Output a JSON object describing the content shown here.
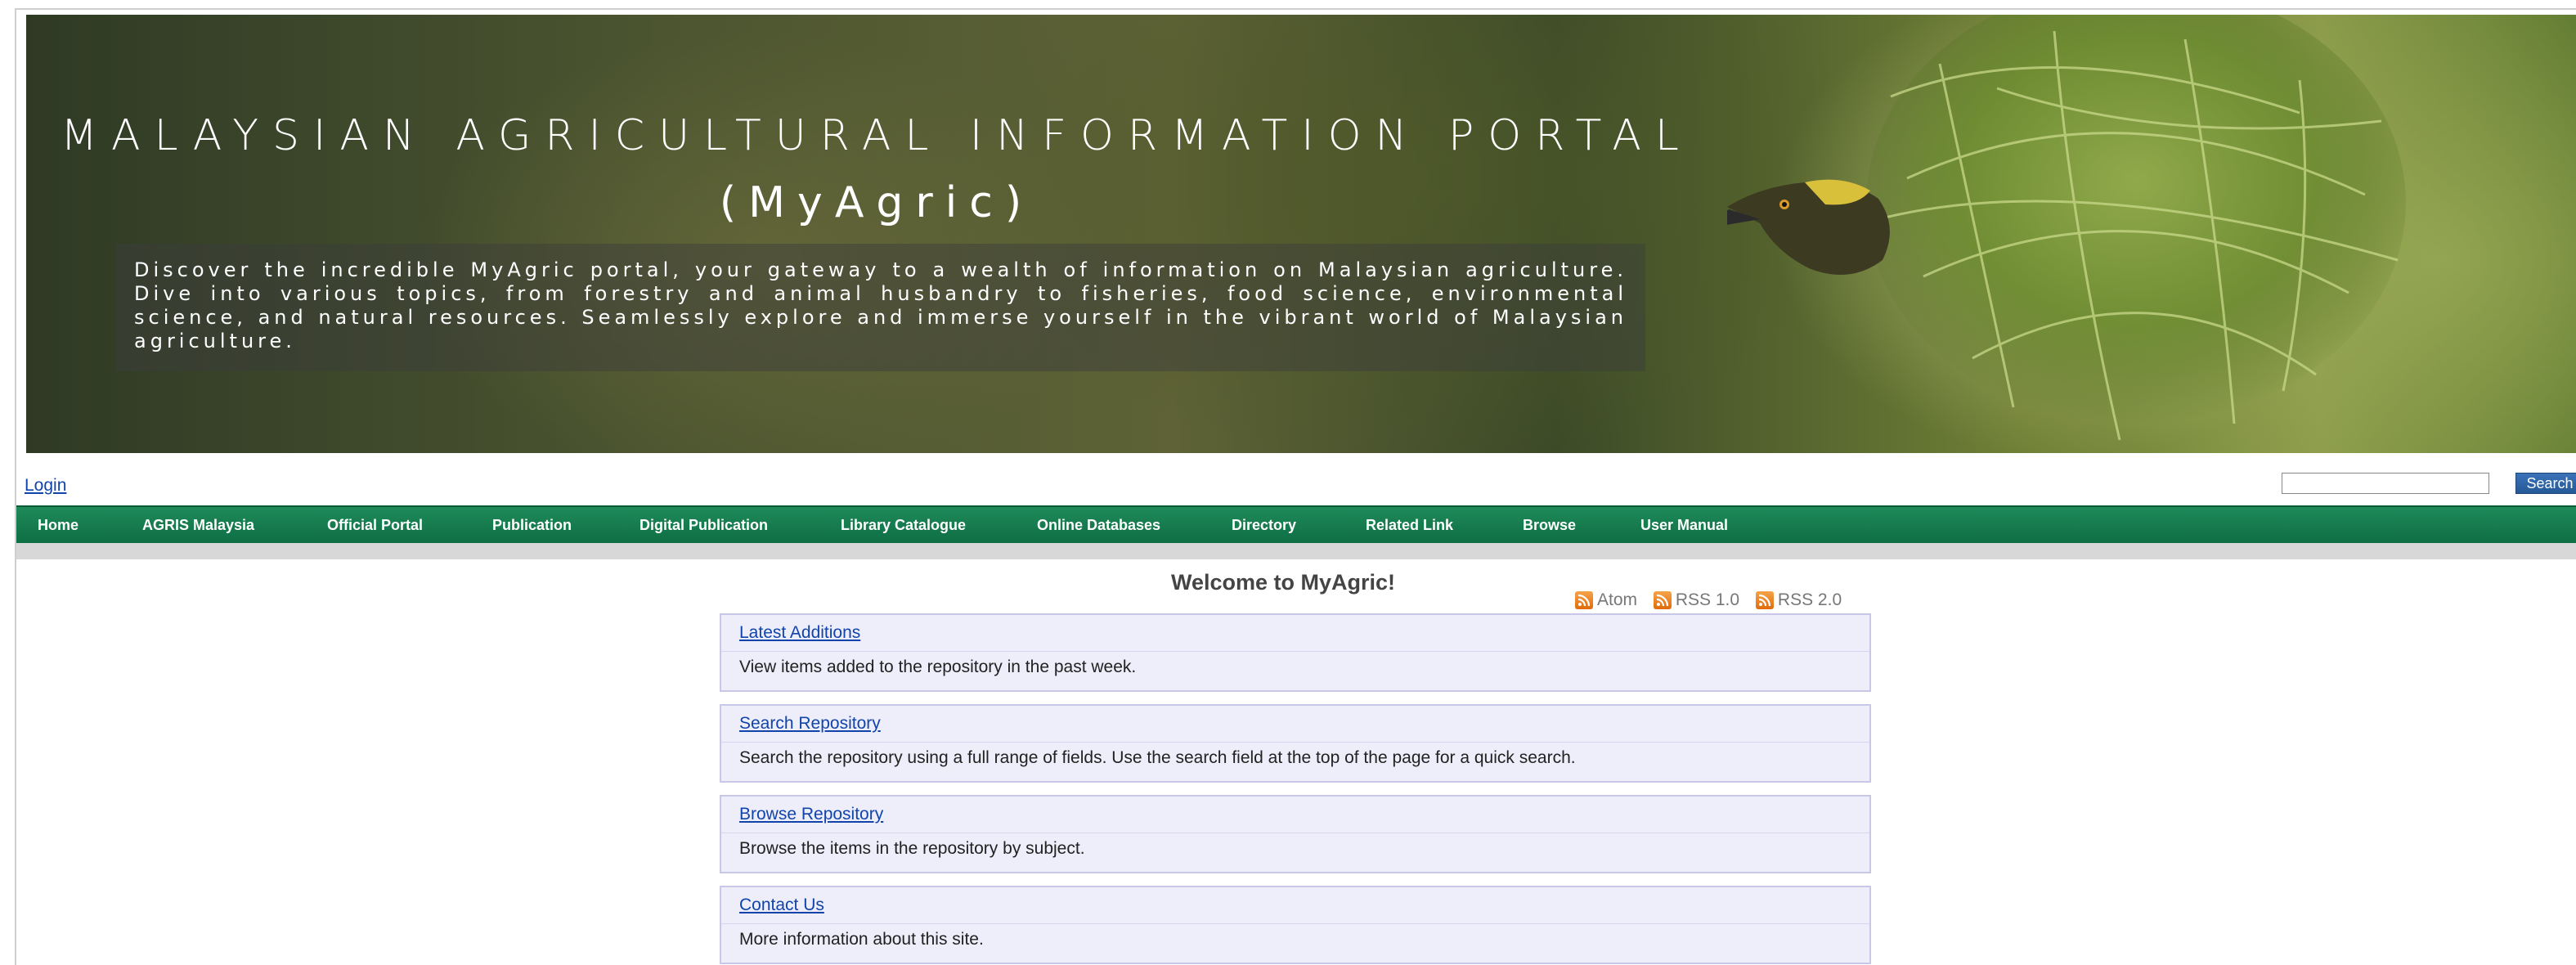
{
  "banner": {
    "title": "MALAYSIAN AGRICULTURAL INFORMATION PORTAL",
    "subtitle": "(MyAgric)",
    "description": "Discover the incredible MyAgric portal, your gateway to a wealth of information on Malaysian agriculture. Dive into various topics, from forestry and animal husbandry to fisheries, food science, environmental science, and natural resources. Seamlessly explore and immerse yourself in the vibrant world of Malaysian agriculture."
  },
  "topbar": {
    "login_label": "Login",
    "search_placeholder": "",
    "search_button_label": "Search"
  },
  "nav": {
    "items": [
      {
        "label": "Home"
      },
      {
        "label": "AGRIS Malaysia"
      },
      {
        "label": "Official Portal"
      },
      {
        "label": "Publication"
      },
      {
        "label": "Digital Publication"
      },
      {
        "label": "Library Catalogue"
      },
      {
        "label": "Online Databases"
      },
      {
        "label": "Directory"
      },
      {
        "label": "Related Link"
      },
      {
        "label": "Browse"
      },
      {
        "label": "User Manual"
      }
    ]
  },
  "main": {
    "welcome_title": "Welcome to MyAgric!",
    "feeds": [
      {
        "label": "Atom",
        "icon": "rss-icon"
      },
      {
        "label": "RSS 1.0",
        "icon": "rss-icon"
      },
      {
        "label": "RSS 2.0",
        "icon": "rss-icon"
      }
    ],
    "cards": [
      {
        "link": "Latest Additions",
        "desc": "View items added to the repository in the past week."
      },
      {
        "link": "Search Repository",
        "desc": "Search the repository using a full range of fields. Use the search field at the top of the page for a quick search."
      },
      {
        "link": "Browse Repository",
        "desc": "Browse the items in the repository by subject."
      },
      {
        "link": "Contact Us",
        "desc": "More information about this site."
      }
    ]
  },
  "colors": {
    "nav_green": "#1f8a5a",
    "link_blue": "#1144aa",
    "card_bg": "#eeeefb",
    "rss_orange": "#e06b0a"
  }
}
